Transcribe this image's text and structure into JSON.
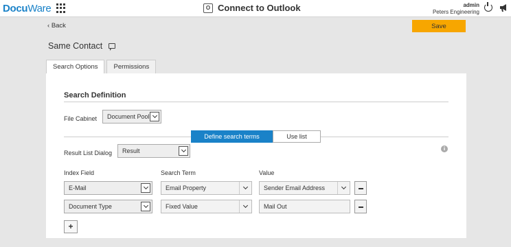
{
  "header": {
    "logo": "DocuWare",
    "app_title": "Connect to Outlook",
    "outlook_icon_letter": "O",
    "user_name": "admin",
    "organization": "Peters Engineering"
  },
  "toolbar": {
    "back_label": "Back",
    "save_label": "Save",
    "save_color": "#f7a600"
  },
  "page": {
    "title": "Same Contact"
  },
  "tabs": [
    {
      "label": "Search Options",
      "active": true
    },
    {
      "label": "Permissions",
      "active": false
    }
  ],
  "search_definition": {
    "title": "Search Definition",
    "file_cabinet_label": "File Cabinet",
    "file_cabinet_value": "Document Pool",
    "mode_buttons": {
      "define": "Define search terms",
      "use_list": "Use list",
      "active_color": "#1a82c8"
    },
    "result_list_label": "Result List Dialog",
    "result_list_value": "Result",
    "columns": {
      "index_field": "Index Field",
      "search_term": "Search Term",
      "value": "Value"
    },
    "rows": [
      {
        "index_field": "E-Mail",
        "search_term": "Email Property",
        "value": "Sender Email Address"
      },
      {
        "index_field": "Document Type",
        "search_term": "Fixed Value",
        "value": "Mail Out"
      }
    ],
    "add_button": "+"
  }
}
